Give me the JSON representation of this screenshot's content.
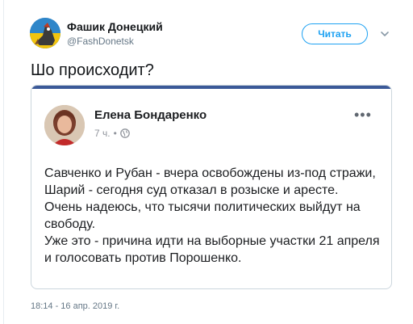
{
  "tweet": {
    "author_name": "Фашик Донецкий",
    "author_handle": "@FashDonetsk",
    "follow_label": "Читать",
    "text": "Шо происходит?",
    "timestamp": "18:14 - 16 апр. 2019 г."
  },
  "embedded_post": {
    "author_name": "Елена Бондаренко",
    "time": "7 ч.",
    "separator": "•",
    "paragraphs": [
      "Савченко и Рубан - вчера освобождены из-под стражи, Шарий - сегодня суд отказал в розыске и аресте.",
      "Очень надеюсь, что тысячи политических выйдут на свободу.",
      "Уже это - причина идти на выборные участки 21 апреля и голосовать против Порошенко."
    ],
    "more_icon": "more-dots-icon",
    "privacy_icon": "globe-icon"
  },
  "colors": {
    "twitter_blue": "#1da1f2",
    "facebook_blue": "#3b5998",
    "secondary_text": "#657786"
  }
}
